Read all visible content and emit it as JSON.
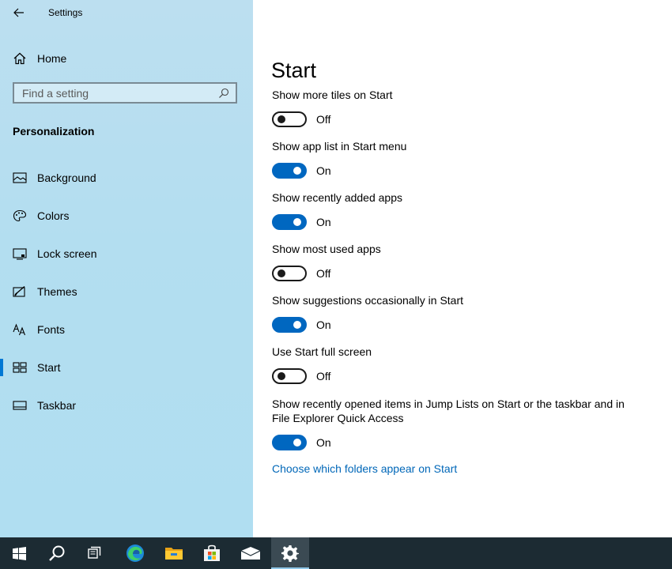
{
  "window": {
    "title": "Settings"
  },
  "sidebar": {
    "home_label": "Home",
    "search_placeholder": "Find a setting",
    "section_heading": "Personalization",
    "items": [
      {
        "label": "Background",
        "icon": "image-icon",
        "selected": false
      },
      {
        "label": "Colors",
        "icon": "palette-icon",
        "selected": false
      },
      {
        "label": "Lock screen",
        "icon": "lock-screen-icon",
        "selected": false
      },
      {
        "label": "Themes",
        "icon": "themes-icon",
        "selected": false
      },
      {
        "label": "Fonts",
        "icon": "fonts-icon",
        "selected": false
      },
      {
        "label": "Start",
        "icon": "start-icon",
        "selected": true
      },
      {
        "label": "Taskbar",
        "icon": "taskbar-icon",
        "selected": false
      }
    ]
  },
  "main": {
    "page_title": "Start",
    "settings": [
      {
        "label": "Show more tiles on Start",
        "state": "Off",
        "on": false
      },
      {
        "label": "Show app list in Start menu",
        "state": "On",
        "on": true
      },
      {
        "label": "Show recently added apps",
        "state": "On",
        "on": true
      },
      {
        "label": "Show most used apps",
        "state": "Off",
        "on": false
      },
      {
        "label": "Show suggestions occasionally in Start",
        "state": "On",
        "on": true
      },
      {
        "label": "Use Start full screen",
        "state": "Off",
        "on": false
      },
      {
        "label": "Show recently opened items in Jump Lists on Start or the taskbar and in File Explorer Quick Access",
        "state": "On",
        "on": true
      }
    ],
    "link_text": "Choose which folders appear on Start"
  },
  "taskbar": {
    "items": [
      {
        "name": "windows-start-icon",
        "active": false
      },
      {
        "name": "search-icon",
        "active": false
      },
      {
        "name": "task-view-icon",
        "active": false
      },
      {
        "name": "edge-icon",
        "active": false
      },
      {
        "name": "file-explorer-icon",
        "active": false
      },
      {
        "name": "store-icon",
        "active": false
      },
      {
        "name": "mail-icon",
        "active": false
      },
      {
        "name": "settings-gear-icon",
        "active": true
      }
    ]
  },
  "colors": {
    "accent": "#0067c0",
    "link": "#0067b8",
    "taskbar": "#1c2b33",
    "sidebar": "#b3def0"
  }
}
